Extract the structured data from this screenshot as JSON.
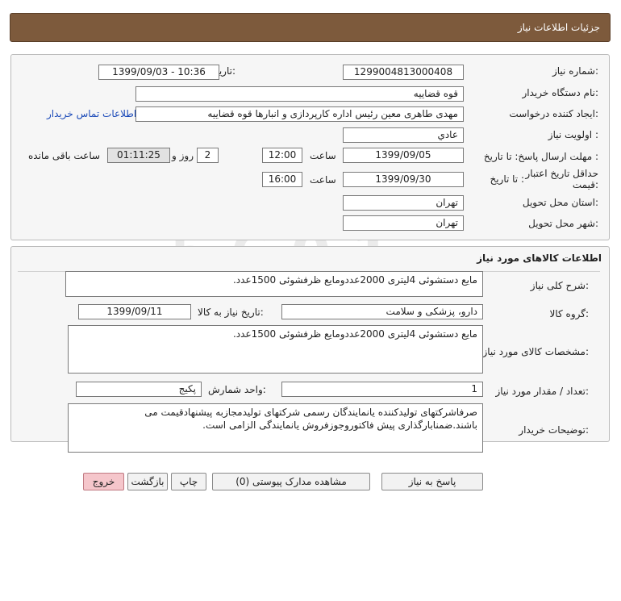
{
  "header": {
    "title": "جزئیات اطلاعات نیاز"
  },
  "need": {
    "number_label": "شماره نیاز:",
    "number": "1299004813000408",
    "announce_label": "تاریخ و ساعت اعلان عمومی:",
    "announce_value": "1399/09/03 - 10:36",
    "buyer_org_label": "نام دستگاه خریدار:",
    "buyer_org": "قوه قضاییه",
    "creator_label": "ایجاد کننده درخواست:",
    "creator": "مهدی طاهری معین رئیس اداره کارپردازی و انبارها قوه قضاییه",
    "contact_link": "اطلاعات تماس خریدار",
    "priority_label": "اولویت نیاز :",
    "priority": "عادي",
    "deadline_label": "مهلت ارسال پاسخ: تا تاریخ :",
    "deadline_date": "1399/09/05",
    "time_label": "ساعت",
    "deadline_time": "12:00",
    "days_value": "2",
    "days_label": "روز و",
    "remaining_time": "01:11:25",
    "remaining_label": "ساعت باقی مانده",
    "validity_label": "حداقل تاریخ اعتبار قیمت:",
    "validity_to_label": "تا تاریخ :",
    "validity_date": "1399/09/30",
    "validity_time": "16:00",
    "province_label": "استان محل تحویل:",
    "province": "تهران",
    "city_label": "شهر محل تحویل:",
    "city": "تهران"
  },
  "goods": {
    "section_title": "اطلاعات کالاهای مورد نیاز",
    "summary_label": "شرح کلی نیاز:",
    "summary": "مایع دستشوئی 4لیتری 2000عددومایع ظرفشوئی 1500عدد.",
    "group_label": "گروه کالا:",
    "group": "دارو، پزشکی و سلامت",
    "need_date_label": "تاریخ نیاز به کالا:",
    "need_date": "1399/09/11",
    "specs_label": "مشخصات کالای مورد نیاز:",
    "specs": "مایع دستشوئی 4لیتری 2000عددومایع ظرفشوئی 1500عدد.",
    "qty_label": "تعداد / مقدار مورد نیاز:",
    "qty": "1",
    "unit_label": "واحد شمارش:",
    "unit": "پکیج",
    "buyer_notes_label": "توضیحات خریدار:",
    "buyer_notes": "صرفاشرکتهای تولیدکننده یانمایندگان رسمی شرکتهای تولیدمجازبه پیشنهادقیمت می باشند.ضمنابارگذاری پیش فاکتوروجوزفروش یانمایندگی الزامی است."
  },
  "actions": {
    "reply": "پاسخ به نیاز",
    "view_docs": "مشاهده مدارک پیوستی (0)",
    "print": "چاپ",
    "back": "بازگشت",
    "exit": "خروج"
  },
  "colors": {
    "header_bg": "#7d5a3c",
    "link": "#1a49b8",
    "exit_bg": "#f5c6cb"
  }
}
